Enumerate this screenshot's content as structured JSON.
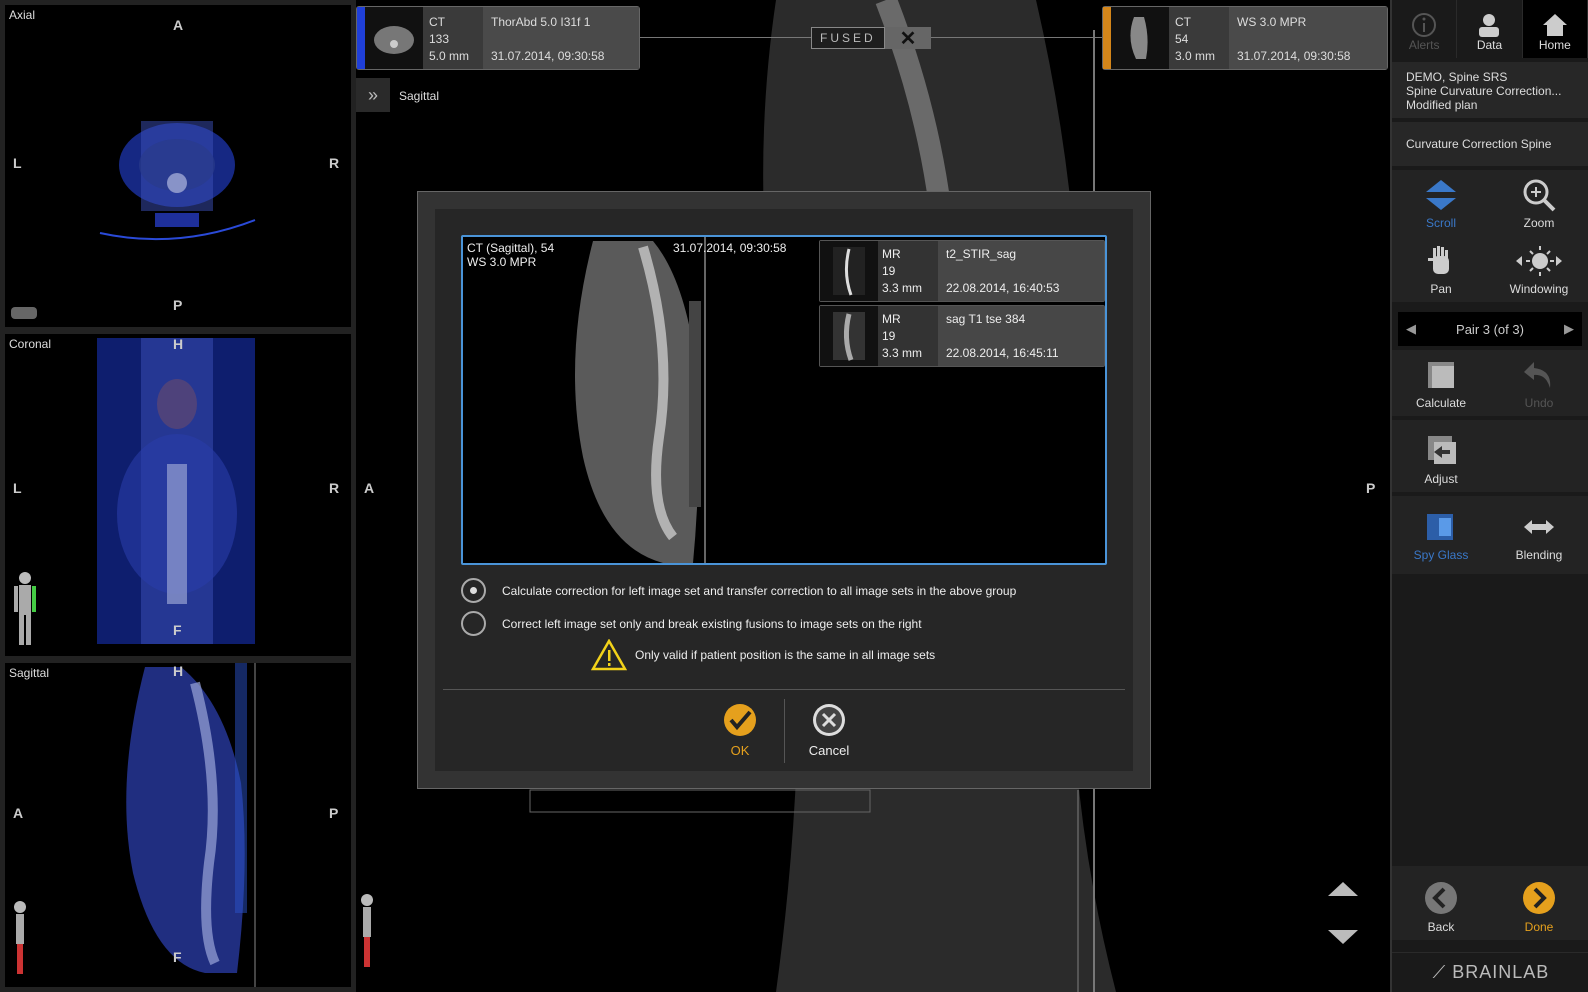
{
  "left_viewports": {
    "axial": {
      "label": "Axial",
      "top": "A",
      "left": "L",
      "right": "R",
      "bottom": "P"
    },
    "coronal": {
      "label": "Coronal",
      "top": "H",
      "left": "L",
      "right": "R",
      "bottom": "F"
    },
    "sagittal": {
      "label": "Sagittal",
      "top": "H",
      "left": "A",
      "right": "P",
      "bottom": "F"
    }
  },
  "main_view": {
    "label": "Sagittal",
    "left_orient": "A",
    "right_orient": "P",
    "fused_label": "FUSED",
    "left_series": {
      "modality": "CT",
      "number": "133",
      "thickness": "5.0 mm",
      "name": "ThorAbd 5.0 I31f 1",
      "date": "31.07.2014, 09:30:58",
      "strip_color": "#1f3fd8"
    },
    "right_series": {
      "modality": "CT",
      "number": "54",
      "thickness": "3.0 mm",
      "name": "WS 3.0 MPR",
      "date": "31.07.2014, 09:30:58",
      "strip_color": "#d4861a"
    }
  },
  "dialog": {
    "preview_title_line1": "CT (Sagittal), 54",
    "preview_title_line2": "WS 3.0 MPR",
    "preview_date": "31.07.2014, 09:30:58",
    "mr_sets": [
      {
        "modality": "MR",
        "number": "19",
        "thickness": "3.3 mm",
        "name": "t2_STIR_sag",
        "date": "22.08.2014, 16:40:53"
      },
      {
        "modality": "MR",
        "number": "19",
        "thickness": "3.3 mm",
        "name": "sag T1 tse 384",
        "date": "22.08.2014, 16:45:11"
      }
    ],
    "option1": "Calculate correction for left image set and transfer correction to all image sets in the above group",
    "option2": "Correct left image set only and break existing fusions to image sets on the right",
    "warning": "Only valid if patient position is the same in all image sets",
    "ok_label": "OK",
    "cancel_label": "Cancel",
    "ok_color": "#e5a01d"
  },
  "sidebar": {
    "alerts": "Alerts",
    "data": "Data",
    "home": "Home",
    "plan_line1": "DEMO, Spine SRS",
    "plan_line2": "Spine Curvature Correction...",
    "plan_line3": "Modified plan",
    "plan_name": "Curvature Correction Spine",
    "scroll": "Scroll",
    "zoom": "Zoom",
    "pan": "Pan",
    "windowing": "Windowing",
    "pair": "Pair 3 (of 3)",
    "calculate": "Calculate",
    "undo": "Undo",
    "adjust": "Adjust",
    "spyglass": "Spy Glass",
    "blending": "Blending",
    "back": "Back",
    "done": "Done",
    "brand": "BRAINLAB"
  }
}
